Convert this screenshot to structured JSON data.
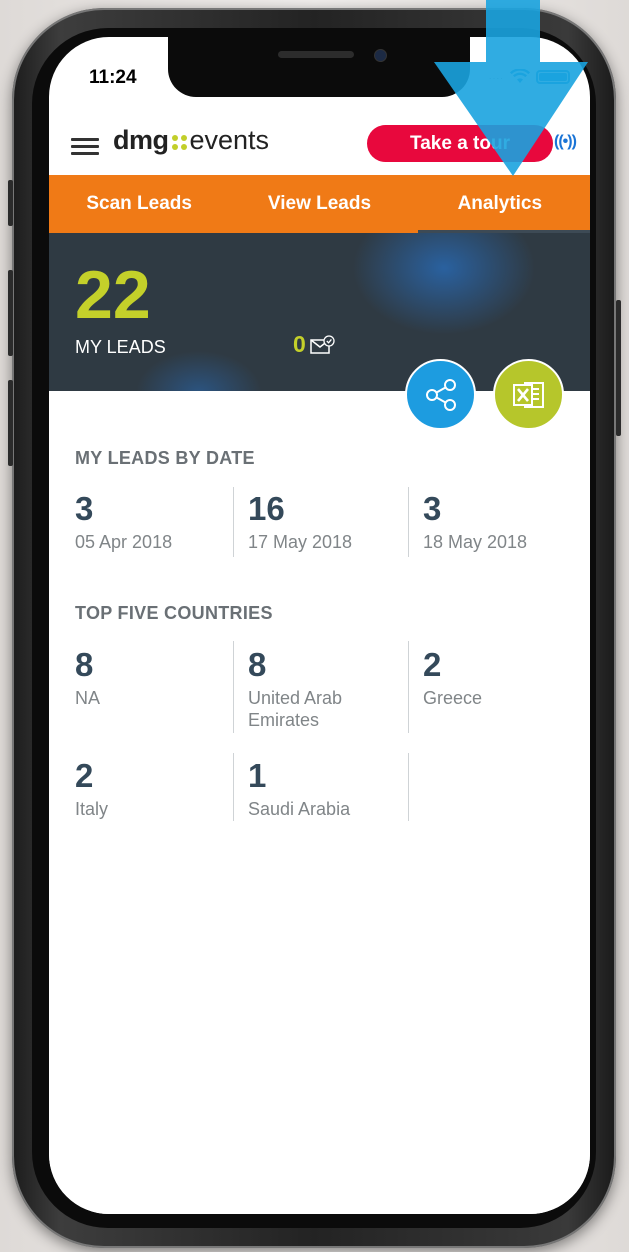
{
  "status_bar": {
    "time": "11:24",
    "signal_icon": "signal-dots-icon",
    "wifi_icon": "wifi-icon",
    "battery_icon": "battery-icon",
    "accent": "#1ea4e0"
  },
  "header": {
    "logo_text_left": "dmg",
    "logo_text_right": "events",
    "tour_button_label": "Take a tour",
    "beacon_icon": "((•))",
    "menu_icon": "hamburger-menu-icon"
  },
  "tabs": [
    {
      "label": "Scan Leads",
      "active": false
    },
    {
      "label": "View Leads",
      "active": false
    },
    {
      "label": "Analytics",
      "active": true
    }
  ],
  "hero": {
    "leads_count": "22",
    "leads_label": "MY LEADS",
    "sent_count": "0",
    "sent_icon": "mail-sent-icon",
    "share_icon": "share-icon",
    "export_icon": "excel-icon"
  },
  "leads_by_date": {
    "title": "MY LEADS BY DATE",
    "items": [
      {
        "count": "3",
        "date": "05 Apr 2018"
      },
      {
        "count": "16",
        "date": "17 May 2018"
      },
      {
        "count": "3",
        "date": "18 May 2018"
      }
    ]
  },
  "top_countries": {
    "title": "TOP FIVE COUNTRIES",
    "items": [
      {
        "count": "8",
        "country": "NA"
      },
      {
        "count": "8",
        "country": "United Arab Emirates"
      },
      {
        "count": "2",
        "country": "Greece"
      },
      {
        "count": "2",
        "country": "Italy"
      },
      {
        "count": "1",
        "country": "Saudi Arabia"
      }
    ]
  },
  "colors": {
    "orange_nav": "#f07a16",
    "lime": "#c4d02a",
    "tour_red": "#e8083d",
    "share_blue": "#1d9ce0",
    "excel_green": "#b6c62b",
    "hero_dark": "#2f3a43",
    "overlay_arrow": "#1aa3df"
  },
  "overlay": {
    "arrow_icon": "down-arrow-icon",
    "points_to": "Analytics"
  }
}
